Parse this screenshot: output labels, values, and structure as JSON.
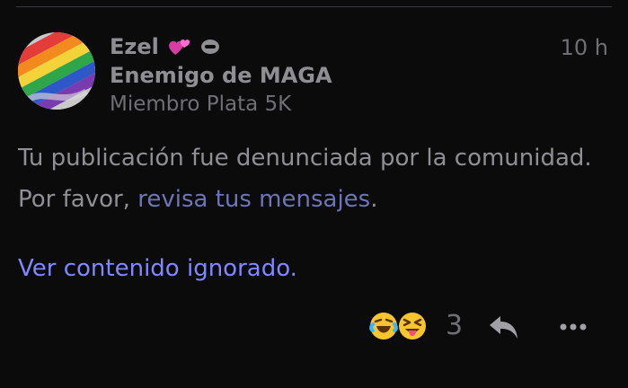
{
  "post": {
    "author": {
      "username": "Ezel",
      "title": "Enemigo de MAGA",
      "rank": "Miembro Plata 5K",
      "avatar_icon": "rainbow-flag-avatar",
      "flair_icons": [
        "two-hearts-icon",
        "badge-icon"
      ]
    },
    "timestamp": "10 h",
    "body": {
      "text_before_link": "Tu publicación fue denunciada por la comunidad. Por favor, ",
      "link_text": "revisa tus mensajes",
      "text_after_link": "."
    },
    "ignored_link": "Ver contenido ignorado.",
    "reactions": {
      "icons": [
        "rofl-emoji",
        "squinting-tongue-emoji"
      ],
      "count": "3"
    },
    "actions": {
      "reply_icon": "reply-icon",
      "more_icon": "more-icon"
    }
  },
  "colors": {
    "background": "#0b0b0c",
    "text": "#8f8f95",
    "muted": "#6f6f75",
    "link": "#6e74b8",
    "link_bright": "#7f88ff"
  }
}
